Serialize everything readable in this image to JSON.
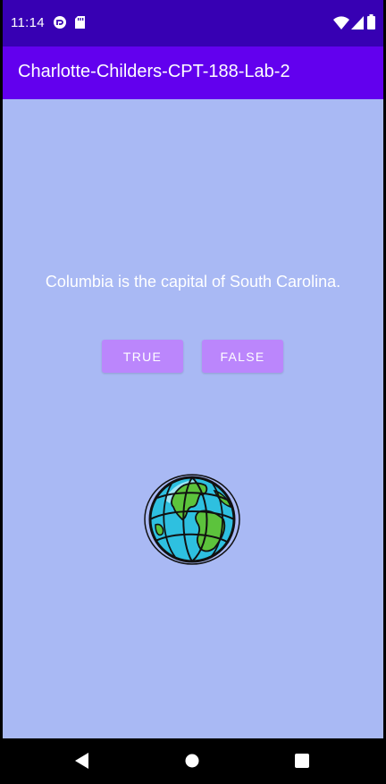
{
  "status_bar": {
    "time": "11:14",
    "background": "#3700B3",
    "icons": [
      "sync-icon",
      "sd-card-icon",
      "wifi-icon",
      "signal-icon",
      "battery-icon"
    ]
  },
  "app_bar": {
    "title": "Charlotte-Childers-CPT-188-Lab-2",
    "background": "#6200EE"
  },
  "main": {
    "background": "#A9B9F4",
    "question": "Columbia is the capital of South Carolina.",
    "buttons": {
      "true_label": "TRUE",
      "false_label": "FALSE",
      "color": "#BB86FC"
    },
    "image": "globe-icon"
  },
  "nav_bar": {
    "buttons": [
      "back-icon",
      "home-icon",
      "recents-icon"
    ]
  }
}
